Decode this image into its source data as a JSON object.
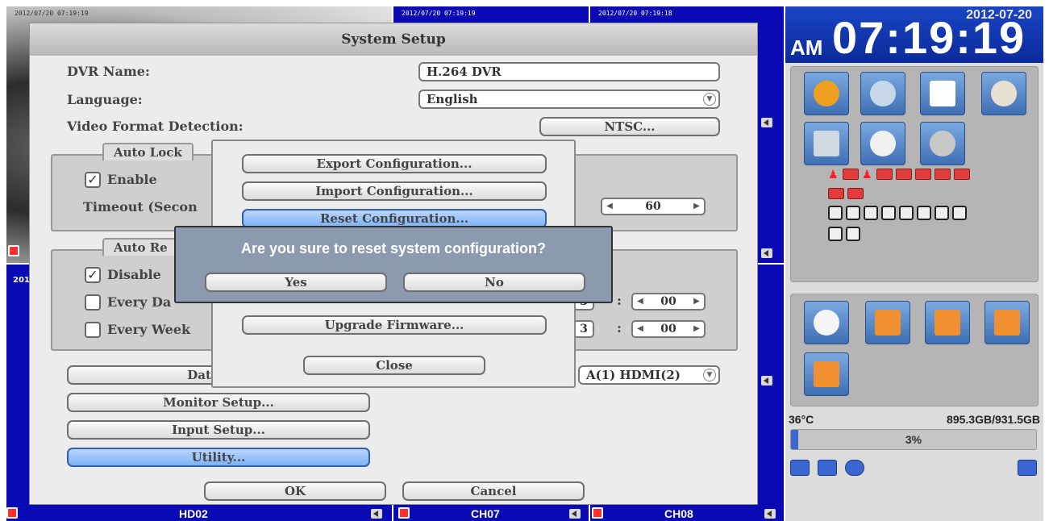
{
  "cameras": [
    {
      "timestamp": "2012/07/20 07:19:19",
      "label": ""
    },
    {
      "timestamp": "2012/07/20 07:19:19",
      "label": "CH07"
    },
    {
      "timestamp": "2012/07/20 07:19:18",
      "label": "CH08"
    },
    {
      "timestamp": "201",
      "label": "HD02"
    }
  ],
  "clock": {
    "date": "2012-07-20",
    "ampm": "AM",
    "time": "07:19:19"
  },
  "status": {
    "temperature": "36°C",
    "storage": "895.3GB/931.5GB",
    "usage_percent": 3,
    "usage_label": "3%"
  },
  "setup": {
    "title": "System Setup",
    "dvr_name_label": "DVR Name:",
    "dvr_name_value": "H.264 DVR",
    "language_label": "Language:",
    "language_value": "English",
    "video_format_label": "Video Format Detection:",
    "video_format_value": "NTSC...",
    "auto_lock_title": "Auto Lock",
    "enable_label": "Enable",
    "timeout_label": "Timeout (Secon",
    "timeout_value": "60",
    "auto_reboot_title": "Auto Re",
    "disable_label": "Disable",
    "every_day_label": "Every Da",
    "every_week_label": "Every Week",
    "hour_value_1": "3",
    "minute_value_1": "00",
    "hour_value_2": "3",
    "minute_value_2": "00",
    "datetime_button": "Date/Tim",
    "output_value": "A(1) HDMI(2)",
    "monitor_button": "Monitor Setup...",
    "input_button": "Input Setup...",
    "utility_button": "Utility...",
    "ok_button": "OK",
    "cancel_button": "Cancel"
  },
  "utility_menu": {
    "export_button": "Export Configuration...",
    "import_button": "Import Configuration...",
    "reset_button": "Reset Configuration...",
    "upgrade_button": "Upgrade Firmware...",
    "close_button": "Close"
  },
  "confirm": {
    "message": "Are you sure to reset system configuration?",
    "yes_button": "Yes",
    "no_button": "No"
  }
}
